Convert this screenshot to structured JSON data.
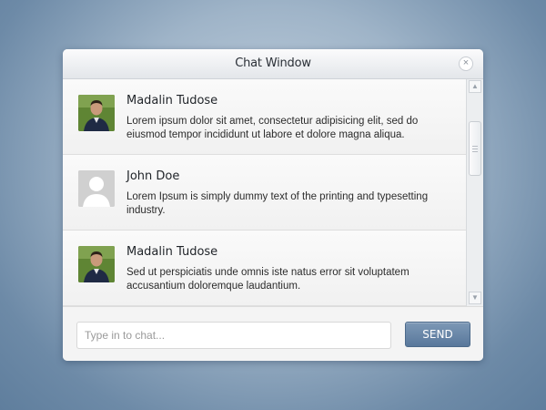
{
  "window": {
    "title": "Chat Window",
    "close_label": "×"
  },
  "messages": [
    {
      "name": "Madalin Tudose",
      "avatar": "user-photo",
      "text": "Lorem ipsum dolor sit amet, consectetur adipisicing elit, sed do eiusmod tempor incididunt ut labore et dolore magna aliqua."
    },
    {
      "name": "John Doe",
      "avatar": "default-user-icon",
      "text": "Lorem Ipsum is simply dummy text of the printing and typesetting industry."
    },
    {
      "name": "Madalin Tudose",
      "avatar": "user-photo",
      "text": "Sed ut perspiciatis unde omnis iste natus error sit voluptatem accusantium doloremque laudantium."
    }
  ],
  "scrollbar": {
    "up_icon": "▲",
    "down_icon": "▼"
  },
  "composer": {
    "placeholder": "Type in to chat...",
    "send_label": "SEND"
  },
  "colors": {
    "accent": "#5f7ea1",
    "background": "#7d97b1"
  }
}
